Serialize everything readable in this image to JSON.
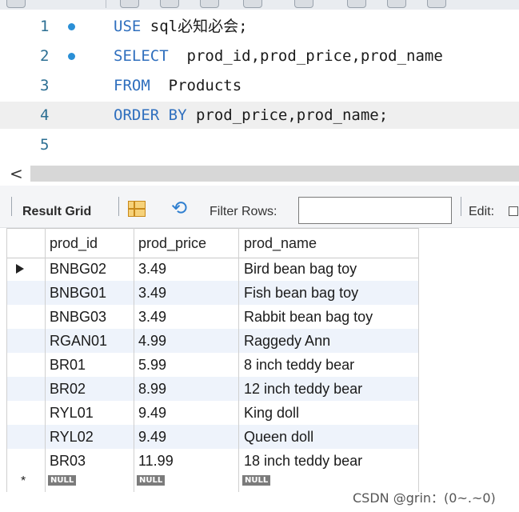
{
  "editor": {
    "lines": [
      {
        "num": "1",
        "breakpoint": true,
        "kw": "USE",
        "rest": " sql必知必会;"
      },
      {
        "num": "2",
        "breakpoint": true,
        "kw": "SELECT",
        "rest": "  prod_id,prod_price,prod_name"
      },
      {
        "num": "3",
        "breakpoint": false,
        "kw": "FROM",
        "rest": "  Products"
      },
      {
        "num": "4",
        "breakpoint": false,
        "kw": "ORDER BY",
        "rest": " prod_price,prod_name;"
      },
      {
        "num": "5",
        "breakpoint": false,
        "kw": "",
        "rest": ""
      }
    ],
    "current_line": 4,
    "scroll_left_glyph": "<"
  },
  "result_bar": {
    "title": "Result Grid",
    "filter_label": "Filter Rows:",
    "filter_value": "",
    "edit_label": "Edit:"
  },
  "grid": {
    "columns": [
      "prod_id",
      "prod_price",
      "prod_name"
    ],
    "rows": [
      [
        "BNBG02",
        "3.49",
        "Bird bean bag toy"
      ],
      [
        "BNBG01",
        "3.49",
        "Fish bean bag toy"
      ],
      [
        "BNBG03",
        "3.49",
        "Rabbit bean bag toy"
      ],
      [
        "RGAN01",
        "4.99",
        "Raggedy Ann"
      ],
      [
        "BR01",
        "5.99",
        "8 inch teddy bear"
      ],
      [
        "BR02",
        "8.99",
        "12 inch teddy bear"
      ],
      [
        "RYL01",
        "9.49",
        "King doll"
      ],
      [
        "RYL02",
        "9.49",
        "Queen doll"
      ],
      [
        "BR03",
        "11.99",
        "18 inch teddy bear"
      ]
    ],
    "null_label": "NULL",
    "new_row_marker": "*"
  },
  "watermark": "CSDN @grin：(0~.~0)",
  "colors": {
    "keyword": "#2f6fbe",
    "line_number": "#2c6f93",
    "breakpoint": "#2a8fd6",
    "alt_row": "#eef3fb"
  }
}
